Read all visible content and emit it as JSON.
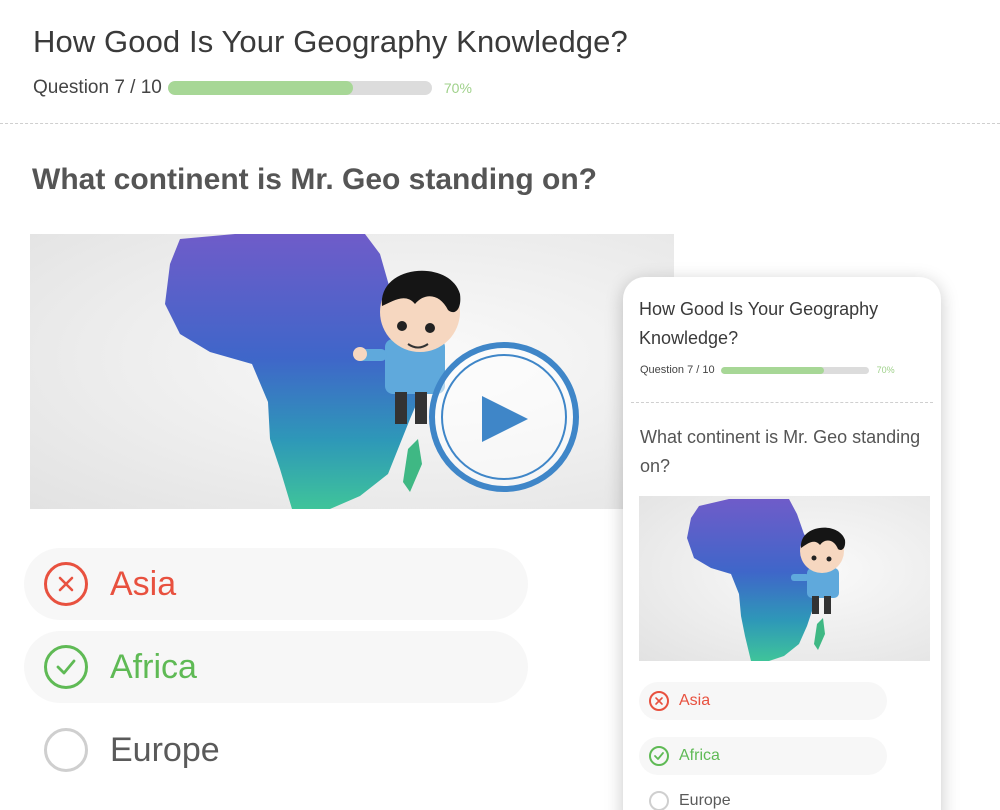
{
  "quiz": {
    "title": "How Good Is Your Geography Knowledge?",
    "counter": "Question 7 / 10",
    "progress_percent": 70,
    "progress_label": "70%",
    "question": "What continent is Mr. Geo standing on?",
    "options": [
      {
        "label": "Asia",
        "state": "wrong",
        "icon": "x-circle-icon"
      },
      {
        "label": "Africa",
        "state": "correct",
        "icon": "check-circle-icon"
      },
      {
        "label": "Europe",
        "state": "unselected",
        "icon": "empty-radio-icon"
      }
    ]
  },
  "phone": {
    "title": "How Good Is Your Geography Knowledge?",
    "counter": "Question 7 / 10",
    "progress_percent": 70,
    "progress_label": "70%",
    "question": "What continent is Mr. Geo standing on?",
    "options": [
      {
        "label": "Asia",
        "state": "wrong"
      },
      {
        "label": "Africa",
        "state": "correct"
      },
      {
        "label": "Europe",
        "state": "unselected"
      }
    ]
  },
  "colors": {
    "wrong": "#e8513f",
    "correct": "#5fba55",
    "progress": "#a7d796",
    "play_button": "#3f86c8"
  }
}
